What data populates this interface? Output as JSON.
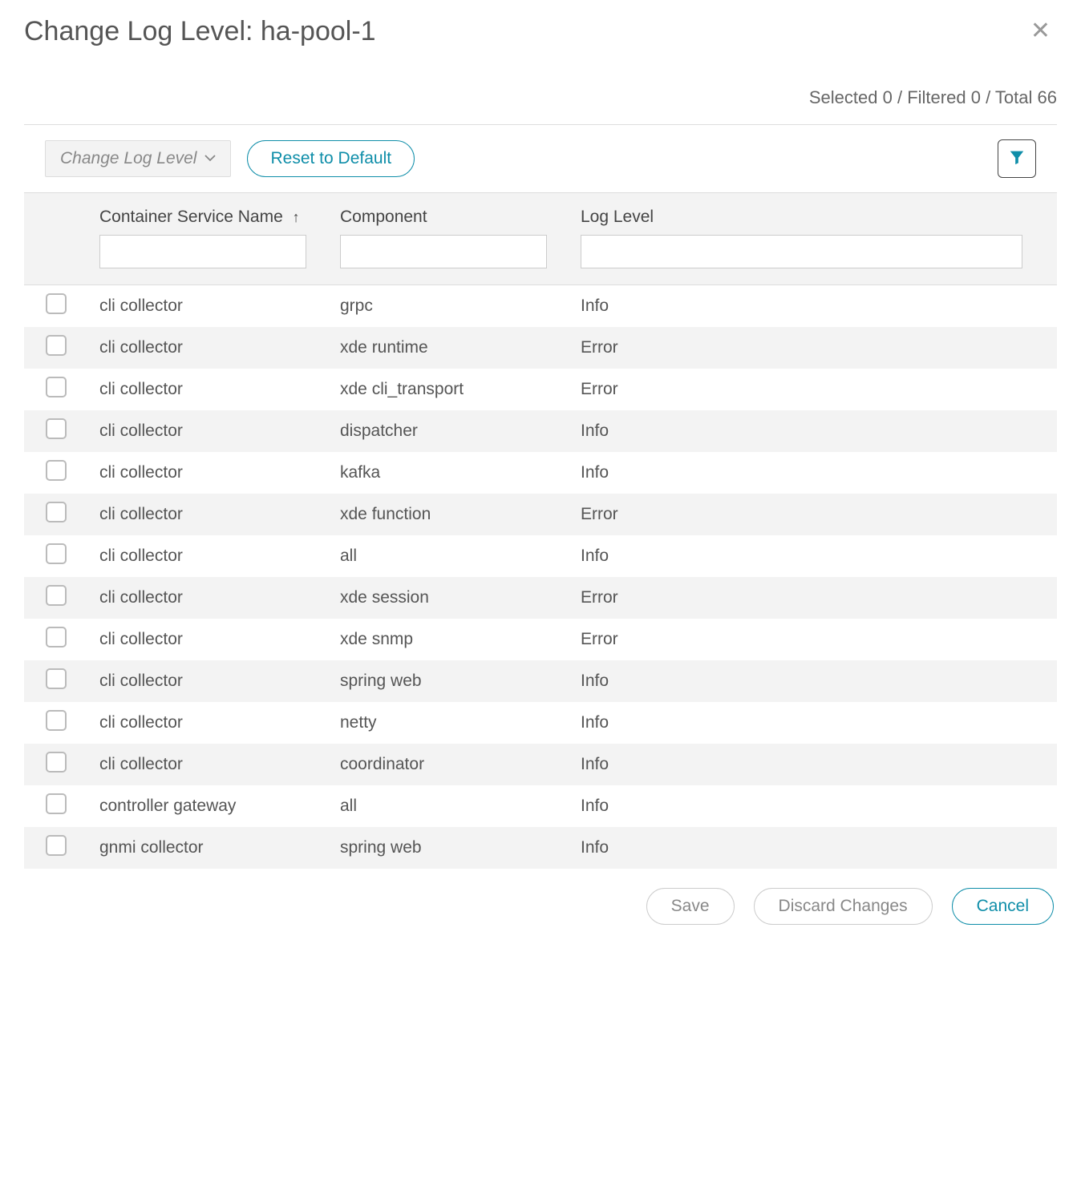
{
  "dialog": {
    "title": "Change Log Level: ha-pool-1"
  },
  "stats": {
    "selected_label": "Selected",
    "selected_count": "0",
    "filtered_label": "Filtered",
    "filtered_count": "0",
    "total_label": "Total",
    "total_count": "66",
    "sep": " / "
  },
  "toolbar": {
    "dropdown_label": "Change Log Level",
    "reset_label": "Reset to Default"
  },
  "table": {
    "headers": {
      "service": "Container Service Name",
      "component": "Component",
      "level": "Log Level"
    },
    "sort_indicator": "↑",
    "rows": [
      {
        "service": "cli collector",
        "component": "grpc",
        "level": "Info"
      },
      {
        "service": "cli collector",
        "component": "xde runtime",
        "level": "Error"
      },
      {
        "service": "cli collector",
        "component": "xde cli_transport",
        "level": "Error"
      },
      {
        "service": "cli collector",
        "component": "dispatcher",
        "level": "Info"
      },
      {
        "service": "cli collector",
        "component": "kafka",
        "level": "Info"
      },
      {
        "service": "cli collector",
        "component": "xde function",
        "level": "Error"
      },
      {
        "service": "cli collector",
        "component": "all",
        "level": "Info"
      },
      {
        "service": "cli collector",
        "component": "xde session",
        "level": "Error"
      },
      {
        "service": "cli collector",
        "component": "xde snmp",
        "level": "Error"
      },
      {
        "service": "cli collector",
        "component": "spring web",
        "level": "Info"
      },
      {
        "service": "cli collector",
        "component": "netty",
        "level": "Info"
      },
      {
        "service": "cli collector",
        "component": "coordinator",
        "level": "Info"
      },
      {
        "service": "controller gateway",
        "component": "all",
        "level": "Info"
      },
      {
        "service": "gnmi collector",
        "component": "spring web",
        "level": "Info"
      }
    ]
  },
  "footer": {
    "save": "Save",
    "discard": "Discard Changes",
    "cancel": "Cancel"
  }
}
